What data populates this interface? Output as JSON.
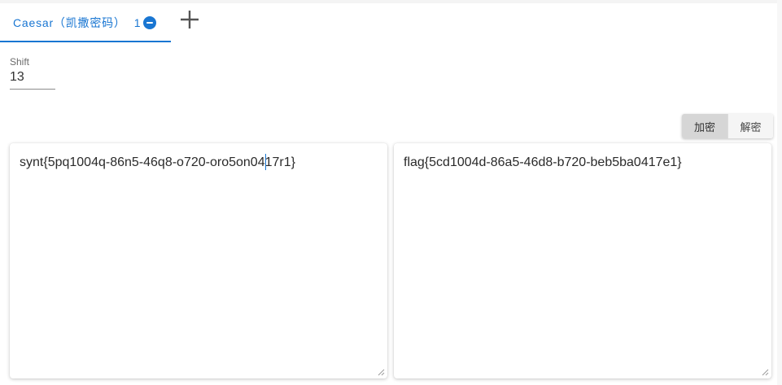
{
  "tab": {
    "label": "Caesar（凯撒密码）",
    "count": "1"
  },
  "icons": {
    "remove": "minus-circle-icon",
    "add": "plus-icon",
    "resize": "resize-grip-icon"
  },
  "shift": {
    "label": "Shift",
    "value": "13"
  },
  "mode": {
    "encrypt_label": "加密",
    "decrypt_label": "解密",
    "selected": "加密"
  },
  "input_text": "synt{5pq1004q-86n5-46q8-o720-oro5on0417r1}",
  "output_text": "flag{5cd1004d-86a5-46d8-b720-beb5ba0417e1}",
  "colors": {
    "accent": "#1976d2",
    "selected_button": "#d6d6d6"
  }
}
